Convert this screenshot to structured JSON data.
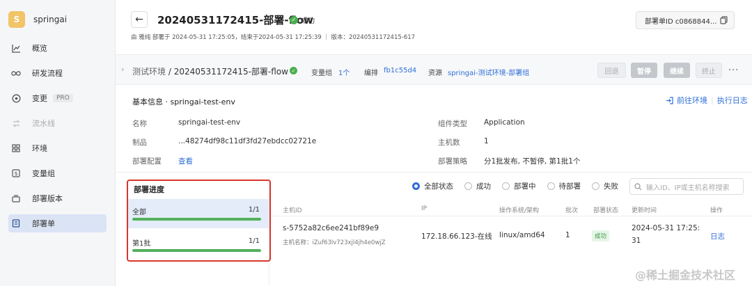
{
  "sidebar": {
    "brand_letter": "S",
    "brand_name": "springai",
    "items": [
      {
        "label": "概览",
        "icon": "chart-line-icon"
      },
      {
        "label": "研发流程",
        "icon": "infinity-icon"
      },
      {
        "label": "变更",
        "icon": "change-icon",
        "badge": "PRO"
      },
      {
        "label": "流水线",
        "icon": "pipeline-icon"
      },
      {
        "label": "环境",
        "icon": "grid-icon"
      },
      {
        "label": "变量组",
        "icon": "dollar-icon"
      },
      {
        "label": "部署版本",
        "icon": "version-icon"
      },
      {
        "label": "部署单",
        "icon": "document-icon"
      }
    ]
  },
  "header": {
    "back_icon": "←",
    "title": "20240531172415-部署-flow",
    "status": "成功",
    "meta": "由 雅纯 部署于 2024-05-31 17:25:05，结束于2024-05-31 17:25:39 ｜ 版本：20240531172415-617",
    "deploy_id": "部署单ID c0868844..."
  },
  "toolbar": {
    "env_prefix": "测试环境",
    "env_name": " / 20240531172415-部署-flow",
    "var_group_label": "变量组",
    "var_group_value": "1个",
    "arrange_label": "编排",
    "arrange_value": "fb1c55d4",
    "resource_label": "资源",
    "resource_value": "springai-测试环境-部署组",
    "buttons": {
      "rollback": "回退",
      "pause": "暂停",
      "continue": "继续",
      "terminate": "终止"
    },
    "more": "···"
  },
  "info": {
    "title": "基本信息 · springai-test-env",
    "goto_env": "前往环境",
    "exec_log": "执行日志",
    "rows": {
      "name_label": "名称",
      "name_value": "springai-test-env",
      "artifact_label": "制品",
      "artifact_value": "...48274df98c11df3fd27ebdcc02721e",
      "config_label": "部署配置",
      "config_value": "查看",
      "component_label": "组件类型",
      "component_value": "Application",
      "hosts_label": "主机数",
      "hosts_value": "1",
      "strategy_label": "部署策略",
      "strategy_value": "分1批发布, 不暂停, 第1批1个"
    }
  },
  "progress": {
    "title": "部署进度",
    "rows": [
      {
        "label": "全部",
        "count": "1/1",
        "fraction": 1.0,
        "selected": true
      },
      {
        "label": "第1批",
        "count": "1/1",
        "fraction": 1.0,
        "selected": false
      }
    ]
  },
  "filters": {
    "options": [
      "全部状态",
      "成功",
      "部署中",
      "待部署",
      "失败"
    ],
    "selected": "全部状态",
    "search_placeholder": "输入ID、IP或主机名称搜索"
  },
  "table": {
    "headers": [
      "主机ID",
      "IP",
      "操作系统/架构",
      "批次",
      "部署状态",
      "更新时间",
      "操作"
    ],
    "row": {
      "host_id": "s-5752a82c6ee241bf89e9",
      "host_name": "主机名称：iZuf63lv723xjl4jh4e0wjZ",
      "ip": "172.18.66.123-在线",
      "os": "linux/amd64",
      "batch": "1",
      "status": "成功",
      "updated_line1": "2024-05-31 17:25:",
      "updated_line2": "31",
      "action": "日志"
    }
  },
  "watermark": "@稀土掘金技术社区",
  "colors": {
    "accent": "#2f6fd6",
    "success": "#52b05a",
    "highlight_border": "#d9362b",
    "brand": "#f2c468"
  }
}
